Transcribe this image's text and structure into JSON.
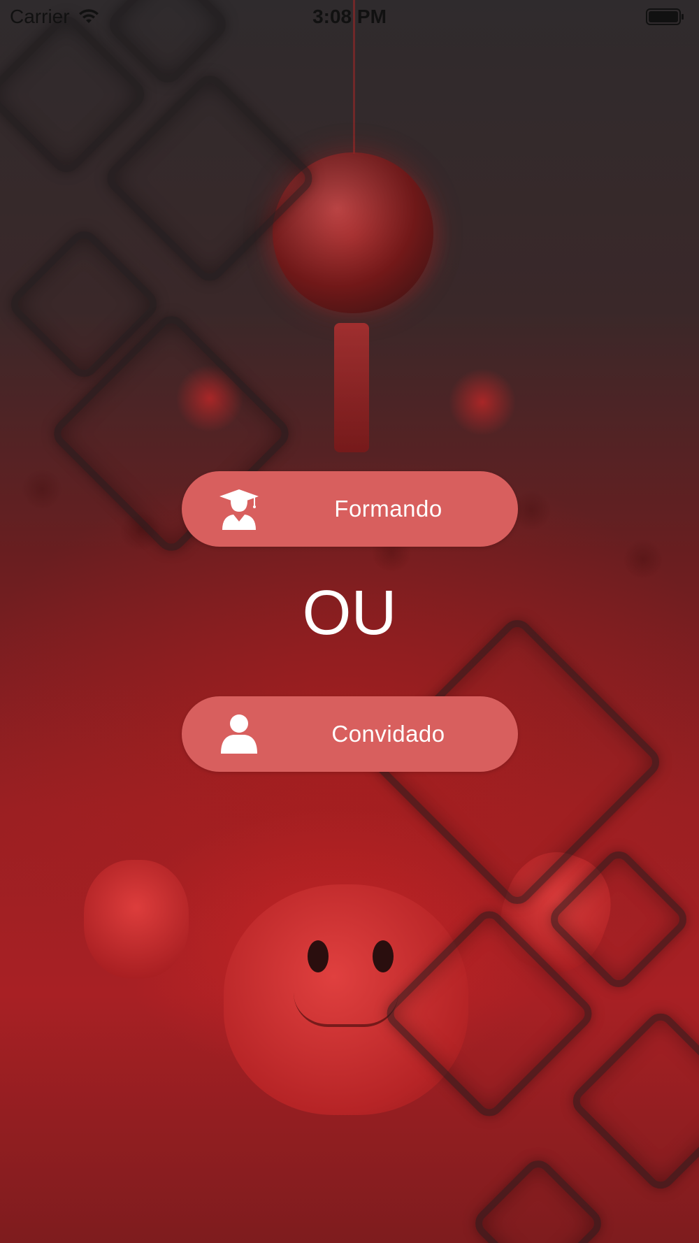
{
  "status_bar": {
    "carrier": "Carrier",
    "time": "3:08 PM"
  },
  "buttons": {
    "formando": {
      "label": "Formando",
      "icon": "graduate-icon"
    },
    "convidado": {
      "label": "Convidado",
      "icon": "user-icon"
    }
  },
  "separator": "OU",
  "colors": {
    "button_background": "#d85f5e",
    "button_text": "#ffffff",
    "background_tint": "#a82024"
  }
}
